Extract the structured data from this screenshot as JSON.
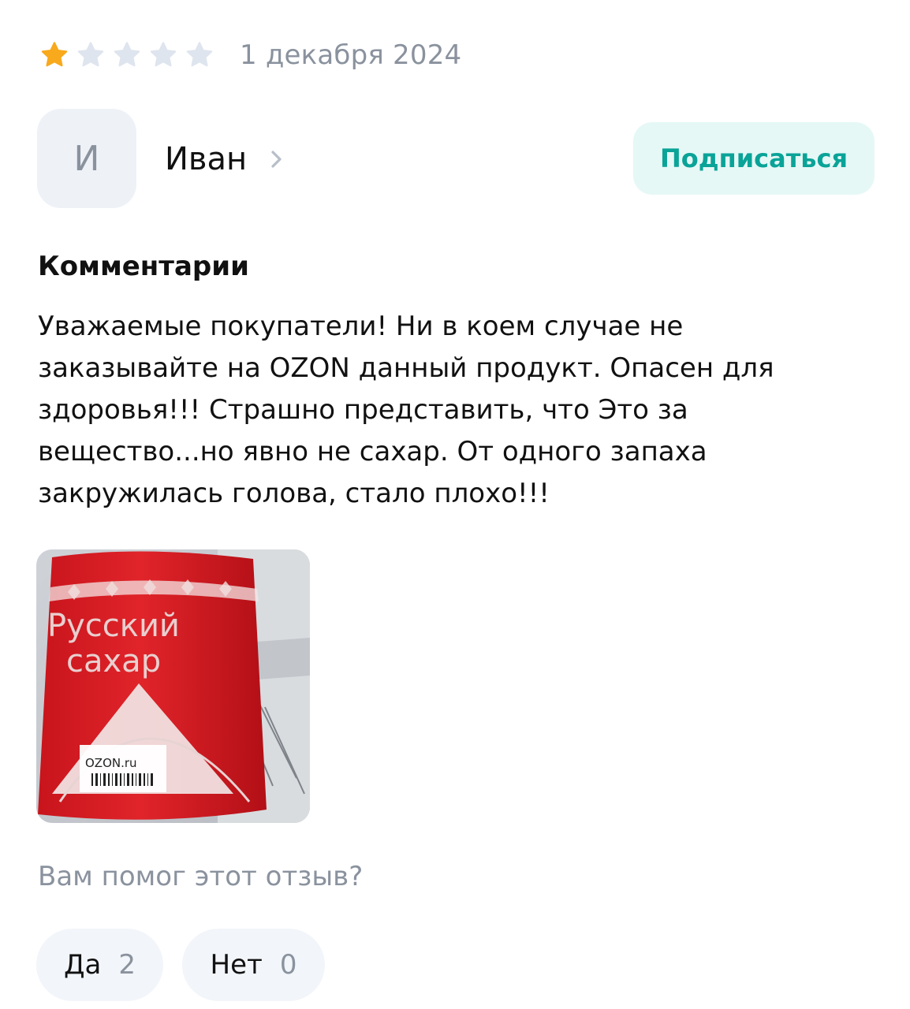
{
  "review": {
    "rating": 1,
    "max_rating": 5,
    "date": "1 декабря 2024"
  },
  "author": {
    "initial": "И",
    "name": "Иван",
    "subscribe_label": "Подписаться"
  },
  "comments": {
    "heading": "Комментарии",
    "text": "Уважаемые покупатели! Ни в коем случае не заказывайте на OZON данный продукт. Опасен для здоровья!!! Страшно представить, что Это за вещество...но явно не сахар. От одного запаха закружилась голова, стало плохо!!!"
  },
  "photo": {
    "package_text_line1": "Русский",
    "package_text_line2": "сахар",
    "label_text": "OZON.ru"
  },
  "helpful": {
    "question": "Вам помог этот отзыв?",
    "yes_label": "Да",
    "yes_count": "2",
    "no_label": "Нет",
    "no_count": "0"
  },
  "colors": {
    "star_active": "#f8a91c",
    "star_inactive": "#dfe5ee",
    "subscribe_bg": "#e5f8f6",
    "subscribe_text": "#0aa398",
    "muted_text": "#8a929e"
  },
  "icons": {
    "star": "star-icon",
    "chevron": "chevron-right-icon"
  }
}
